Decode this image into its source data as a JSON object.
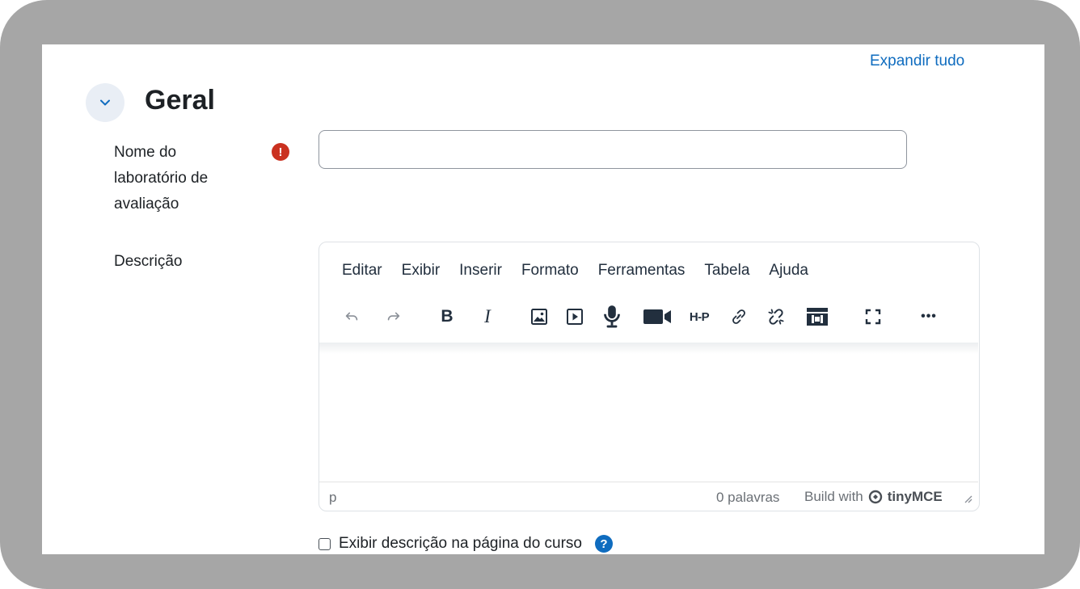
{
  "header": {
    "expand_all": "Expandir tudo"
  },
  "section": {
    "title": "Geral",
    "toggle_icon": "chevron-down-icon"
  },
  "fields": {
    "name": {
      "label": "Nome do laboratório de avaliação",
      "required_icon": "!",
      "value": "",
      "placeholder": ""
    },
    "description": {
      "label": "Descrição"
    }
  },
  "editor": {
    "menu": [
      "Editar",
      "Exibir",
      "Inserir",
      "Formato",
      "Ferramentas",
      "Tabela",
      "Ajuda"
    ],
    "toolbar": {
      "bold": "B",
      "italic": "I",
      "h5p": "H-P",
      "more": "•••",
      "icons": [
        "undo-icon",
        "redo-icon",
        "bold-icon",
        "italic-icon",
        "image-icon",
        "media-icon",
        "microphone-icon",
        "video-icon",
        "h5p-icon",
        "link-icon",
        "unlink-icon",
        "content-bank-icon",
        "fullscreen-icon",
        "more-icon"
      ]
    },
    "status": {
      "path": "p",
      "words": "0 palavras",
      "build_prefix": "Build with",
      "brand": "tinyMCE"
    }
  },
  "show_description": {
    "label": "Exibir descrição na página do curso",
    "checked": false,
    "help_icon": "?"
  },
  "colors": {
    "link": "#0f6cbf",
    "required": "#ca3120",
    "frame": "#a6a6a6"
  }
}
